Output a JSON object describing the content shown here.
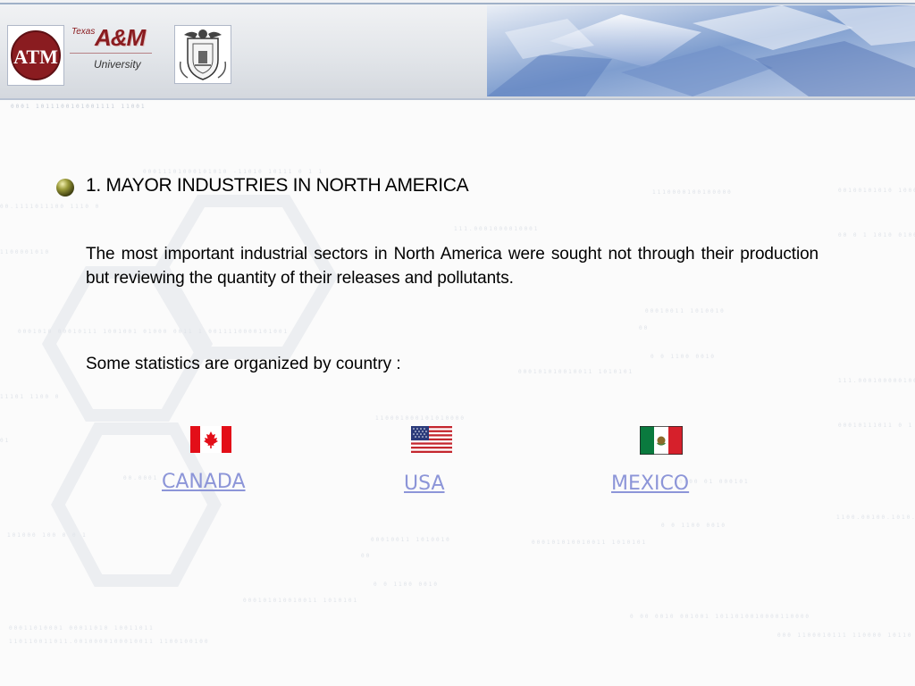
{
  "header": {
    "logo_letters": "ATM",
    "wordmark_texas": "Texas",
    "wordmark_am": "A&M",
    "wordmark_university": "University"
  },
  "section": {
    "title": "1. MAYOR INDUSTRIES IN NORTH AMERICA",
    "paragraph": "The most important industrial sectors in North America were sought not through their production but reviewing the quantity of their releases and pollutants.",
    "subheading": "Some statistics are organized by country :"
  },
  "countries": [
    {
      "label": "CANADA",
      "flag": "canada-flag-icon"
    },
    {
      "label": "USA",
      "flag": "usa-flag-icon"
    },
    {
      "label": "MEXICO",
      "flag": "mexico-flag-icon"
    }
  ],
  "colors": {
    "link": "#8c95d8",
    "brand_maroon": "#8a1c20",
    "header_border": "#b8c2d2"
  }
}
